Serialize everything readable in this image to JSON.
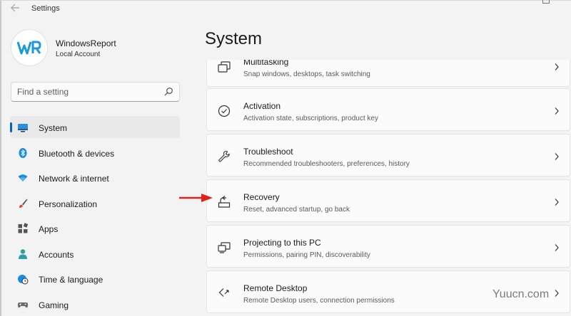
{
  "window": {
    "title": "Settings"
  },
  "account": {
    "initials": "WR",
    "name": "WindowsReport",
    "type": "Local Account"
  },
  "search": {
    "placeholder": "Find a setting"
  },
  "nav": [
    {
      "label": "System",
      "icon": "system-icon",
      "active": true
    },
    {
      "label": "Bluetooth & devices",
      "icon": "bluetooth-icon"
    },
    {
      "label": "Network & internet",
      "icon": "wifi-icon"
    },
    {
      "label": "Personalization",
      "icon": "brush-icon"
    },
    {
      "label": "Apps",
      "icon": "apps-icon"
    },
    {
      "label": "Accounts",
      "icon": "person-icon"
    },
    {
      "label": "Time & language",
      "icon": "globe-clock-icon"
    },
    {
      "label": "Gaming",
      "icon": "gamepad-icon"
    }
  ],
  "main": {
    "title": "System",
    "cards": [
      {
        "title": "Multitasking",
        "subtitle": "Snap windows, desktops, task switching",
        "icon": "multitasking-icon"
      },
      {
        "title": "Activation",
        "subtitle": "Activation state, subscriptions, product key",
        "icon": "check-circle-icon"
      },
      {
        "title": "Troubleshoot",
        "subtitle": "Recommended troubleshooters, preferences, history",
        "icon": "wrench-icon"
      },
      {
        "title": "Recovery",
        "subtitle": "Reset, advanced startup, go back",
        "icon": "recovery-icon"
      },
      {
        "title": "Projecting to this PC",
        "subtitle": "Permissions, pairing PIN, discoverability",
        "icon": "projecting-icon"
      },
      {
        "title": "Remote Desktop",
        "subtitle": "Remote Desktop users, connection permissions",
        "icon": "remote-desktop-icon"
      }
    ]
  },
  "watermark": "Yuucn.com",
  "colors": {
    "accent": "#0067c0",
    "annotation_arrow": "#e0201c"
  }
}
